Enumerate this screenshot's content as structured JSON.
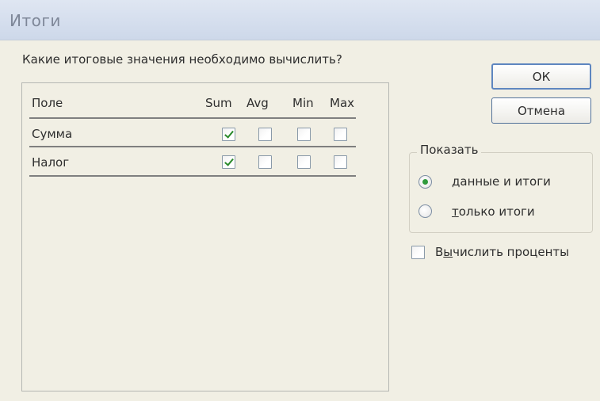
{
  "window": {
    "title": "Итоги"
  },
  "prompt": "Какие итоговые значения необходимо вычислить?",
  "grid": {
    "columns": [
      "Поле",
      "Sum",
      "Avg",
      "Min",
      "Max"
    ],
    "rows": [
      {
        "field": "Сумма",
        "sum": true,
        "avg": false,
        "min": false,
        "max": false
      },
      {
        "field": "Налог",
        "sum": true,
        "avg": false,
        "min": false,
        "max": false
      }
    ]
  },
  "buttons": {
    "ok": "ОК",
    "cancel": "Отмена"
  },
  "show_group": {
    "legend": "Показать",
    "options": [
      {
        "label_ul": "д",
        "label_rest": "анные и итоги",
        "selected": true
      },
      {
        "label_ul": "т",
        "label_rest": "олько итоги",
        "selected": false
      }
    ]
  },
  "percent_checkbox": {
    "label_pre": "В",
    "label_ul": "ы",
    "label_rest": "числить проценты",
    "checked": false
  }
}
